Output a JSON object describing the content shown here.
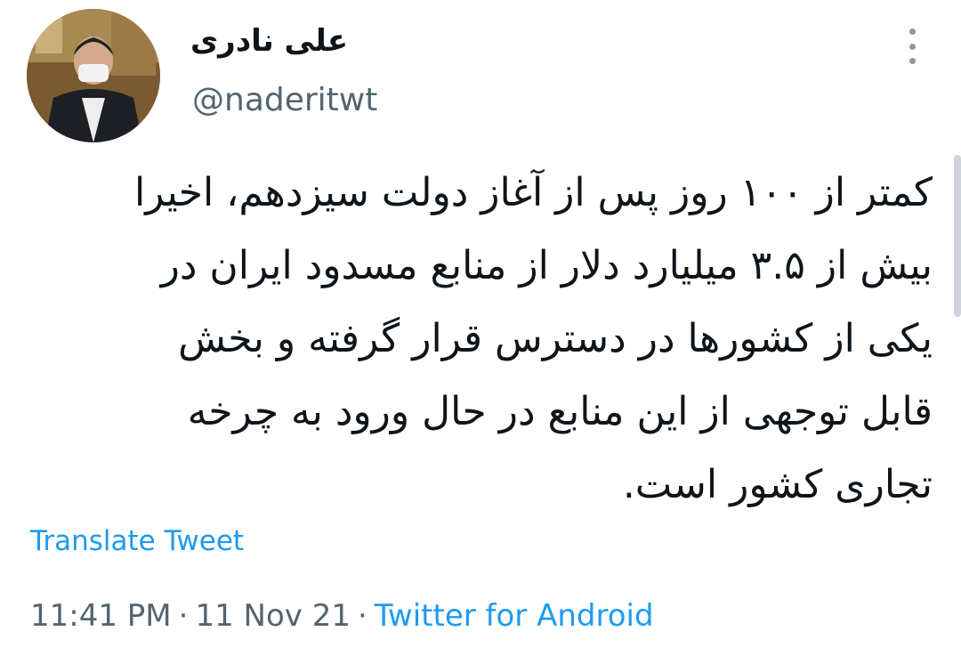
{
  "author": {
    "display_name": "علی نادری",
    "handle": "@naderitwt",
    "avatar_icon": "profile-photo"
  },
  "tweet": {
    "lines": [
      "کمتر از ۱۰۰ روز پس از آغاز دولت سیزدهم، اخیرا",
      "بیش از ۳.۵ میلیارد دلار از منابع مسدود ایران در",
      "یکی از کشورها در دسترس قرار گرفته و بخش",
      "قابل توجهی از این منابع در حال ورود به چرخه",
      "تجاری کشور است."
    ]
  },
  "actions": {
    "translate_label": "Translate Tweet",
    "more_icon": "vertical-ellipsis-icon"
  },
  "meta": {
    "time": "11:41 PM",
    "separator": "·",
    "date": "11 Nov 21",
    "source": "Twitter for Android"
  },
  "colors": {
    "link": "#1d9bf0",
    "secondary_text": "#536471",
    "primary_text": "#0f1419"
  }
}
